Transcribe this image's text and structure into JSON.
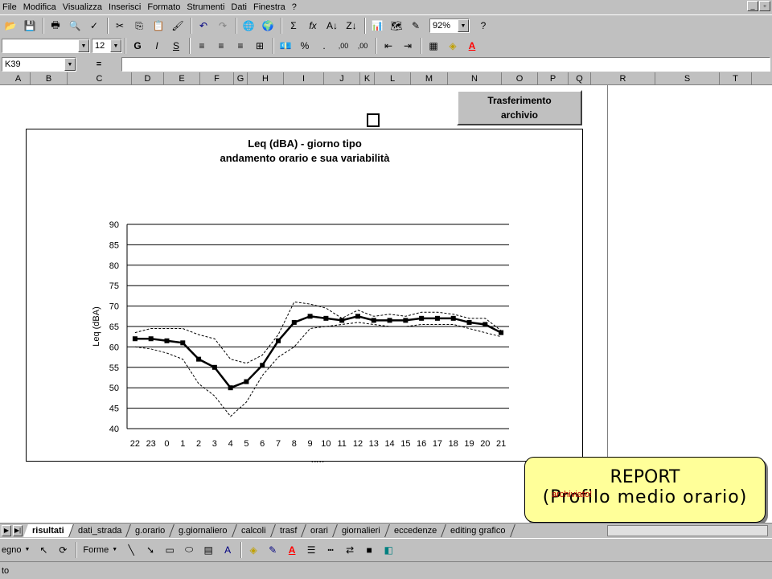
{
  "menu": [
    "File",
    "Modifica",
    "Visualizza",
    "Inserisci",
    "Formato",
    "Strumenti",
    "Dati",
    "Finestra",
    "?"
  ],
  "toolbar": {
    "zoom": "92%",
    "sum_icon": "Σ",
    "fx_icon": "fx",
    "percent": "%",
    "thousands": ".",
    "inc_decimal": ",00",
    "dec_decimal": ",00"
  },
  "format": {
    "font_name": "",
    "font_size": "12",
    "bold": "G",
    "italic": "I",
    "underline": "S"
  },
  "formula_bar": {
    "name_box": "K39",
    "equals": "="
  },
  "columns": [
    "A",
    "B",
    "C",
    "D",
    "E",
    "F",
    "G",
    "H",
    "I",
    "J",
    "K",
    "L",
    "M",
    "N",
    "O",
    "P",
    "Q",
    "R",
    "S",
    "T"
  ],
  "button_trasferimento": "Trasferimento\narchivio",
  "report": {
    "line1": "REPORT",
    "line2": "(Profilo medio orario)"
  },
  "archiviato": "archiviato!",
  "tabs": [
    "risultati",
    "dati_strada",
    "g.orario",
    "g.giornaliero",
    "calcoli",
    "trasf",
    "orari",
    "giornalieri",
    "eccedenze",
    "editing grafico"
  ],
  "drawbar": {
    "disegno": "egno",
    "forme": "Forme"
  },
  "status": "to",
  "chart_data": {
    "type": "line",
    "title": "Leq (dBA) - giorno tipo",
    "subtitle": "andamento orario e sua variabilità",
    "xlabel": "ore",
    "ylabel": "Leq (dBA)",
    "ylim": [
      40,
      90
    ],
    "yticks": [
      40,
      45,
      50,
      55,
      60,
      65,
      70,
      75,
      80,
      85,
      90
    ],
    "categories": [
      "22",
      "23",
      "0",
      "1",
      "2",
      "3",
      "4",
      "5",
      "6",
      "7",
      "8",
      "9",
      "10",
      "11",
      "12",
      "13",
      "14",
      "15",
      "16",
      "17",
      "18",
      "19",
      "20",
      "21"
    ],
    "grid": true,
    "series": [
      {
        "values": [
          62,
          62,
          61.5,
          61,
          57,
          55,
          50,
          51.5,
          55.5,
          61.5,
          66,
          67.5,
          67,
          66.5,
          67.5,
          66.5,
          66.5,
          66.5,
          67,
          67,
          67,
          66,
          65.5,
          63.5
        ],
        "style": "solid-markers",
        "color": "#000000"
      },
      {
        "values": [
          63.5,
          64.5,
          64.5,
          64.5,
          63,
          62,
          57,
          56,
          58,
          63,
          71,
          70.5,
          69.5,
          67,
          69,
          67.5,
          68,
          67.5,
          68.5,
          68.5,
          68,
          67,
          67,
          64
        ],
        "style": "dashed",
        "color": "#000000"
      },
      {
        "values": [
          60,
          59.5,
          58.5,
          57,
          51,
          48,
          43,
          46.5,
          53,
          57.5,
          60,
          64.5,
          65,
          65.5,
          66,
          65.5,
          65,
          65,
          65.5,
          65.5,
          65.5,
          64.5,
          63.5,
          62.5
        ],
        "style": "dashed",
        "color": "#000000"
      }
    ]
  }
}
